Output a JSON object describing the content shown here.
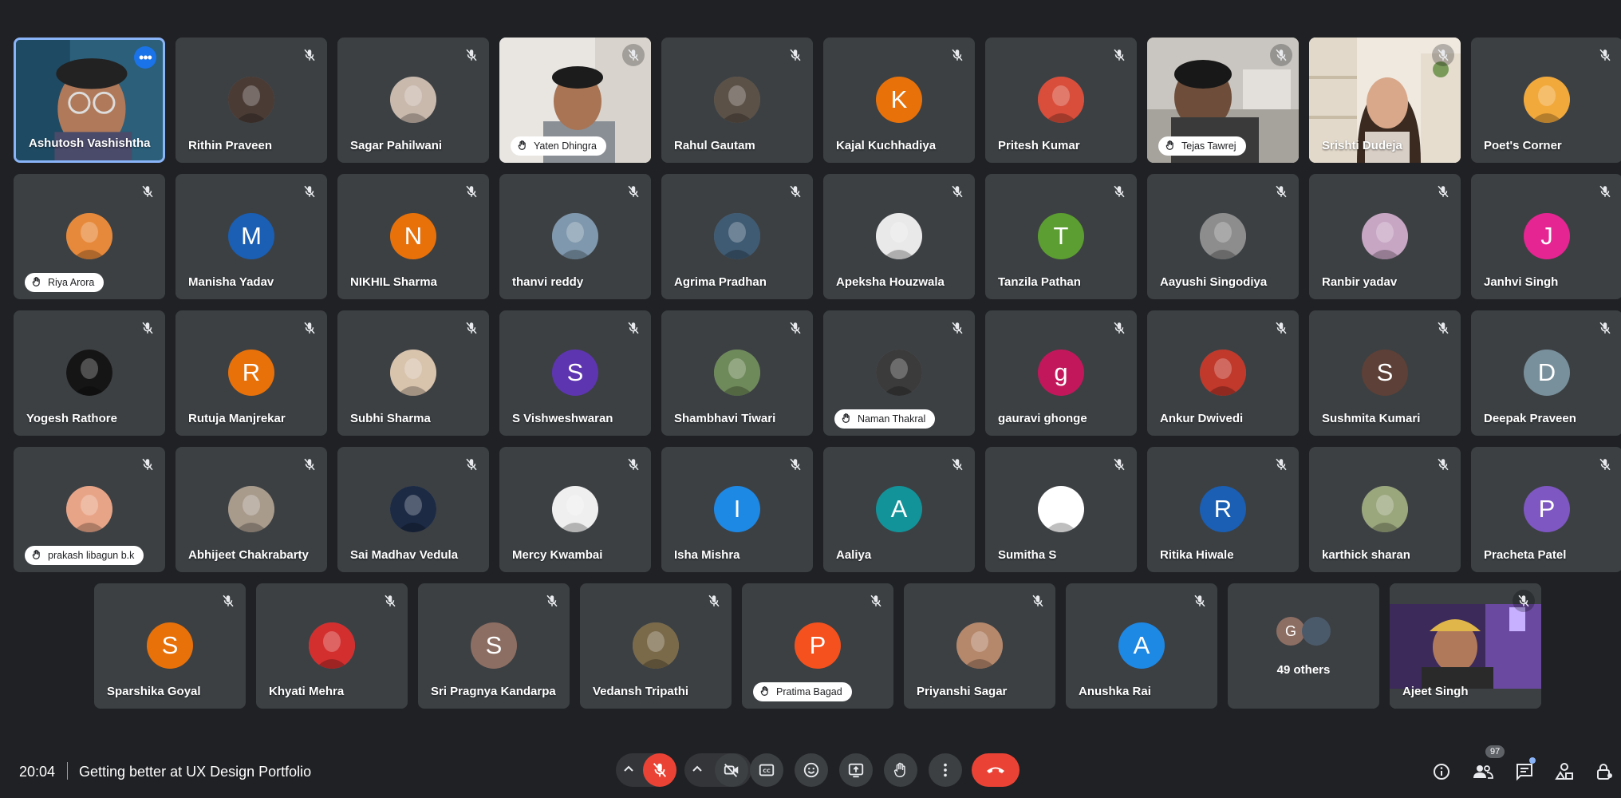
{
  "participants": [
    {
      "name": "Ashutosh Vashishtha",
      "kind": "video",
      "scene": "self",
      "speaking": true,
      "menu": true
    },
    {
      "name": "Rithin Praveen",
      "kind": "photo",
      "ph": "#4a3b35",
      "muted": true
    },
    {
      "name": "Sagar Pahilwani",
      "kind": "photo",
      "ph": "#c9b9ad",
      "muted": true
    },
    {
      "name": "Yaten Dhingra",
      "kind": "video",
      "scene": "wall",
      "pill": true,
      "muted": true
    },
    {
      "name": "Rahul Gautam",
      "kind": "photo",
      "ph": "#5b5147",
      "muted": true
    },
    {
      "name": "Kajal Kuchhadiya",
      "kind": "letter",
      "letter": "K",
      "color": "#e8710a",
      "muted": true
    },
    {
      "name": "Pritesh Kumar",
      "kind": "photo",
      "ph": "#d94e3b",
      "muted": true
    },
    {
      "name": "Tejas Tawrej",
      "kind": "video",
      "scene": "room",
      "pill": true,
      "muted": true
    },
    {
      "name": "Srishti Dudeja",
      "kind": "video",
      "scene": "shelf",
      "muted": true
    },
    {
      "name": "Poet's Corner",
      "kind": "photo",
      "ph": "#f2a93b",
      "muted": true
    },
    {
      "name": "Riya Arora",
      "kind": "photo",
      "ph": "#e7893a",
      "pill": true,
      "muted": true
    },
    {
      "name": "Manisha Yadav",
      "kind": "letter",
      "letter": "M",
      "color": "#1a5fb4",
      "muted": true
    },
    {
      "name": "NIKHIL Sharma",
      "kind": "letter",
      "letter": "N",
      "color": "#e8710a",
      "muted": true
    },
    {
      "name": "thanvi reddy",
      "kind": "photo",
      "ph": "#7f98ad",
      "muted": true
    },
    {
      "name": "Agrima Pradhan",
      "kind": "photo",
      "ph": "#3f5b73",
      "muted": true
    },
    {
      "name": "Apeksha Houzwala",
      "kind": "photo",
      "ph": "#e9e9e9",
      "muted": true
    },
    {
      "name": "Tanzila Pathan",
      "kind": "letter",
      "letter": "T",
      "color": "#5c9e31",
      "muted": true
    },
    {
      "name": "Aayushi Singodiya",
      "kind": "photo",
      "ph": "#8d8d8d",
      "muted": true
    },
    {
      "name": "Ranbir yadav",
      "kind": "photo",
      "ph": "#c7a6c4",
      "muted": true
    },
    {
      "name": "Janhvi Singh",
      "kind": "letter",
      "letter": "J",
      "color": "#e52592",
      "muted": true
    },
    {
      "name": "Yogesh Rathore",
      "kind": "photo",
      "ph": "#151515",
      "muted": true
    },
    {
      "name": "Rutuja Manjrekar",
      "kind": "letter",
      "letter": "R",
      "color": "#e8710a",
      "muted": true
    },
    {
      "name": "Subhi Sharma",
      "kind": "photo",
      "ph": "#d8c3ad",
      "muted": true
    },
    {
      "name": "S Vishweshwaran",
      "kind": "letter",
      "letter": "S",
      "color": "#5e35b1",
      "muted": true
    },
    {
      "name": "Shambhavi Tiwari",
      "kind": "photo",
      "ph": "#6f8a5a",
      "muted": true
    },
    {
      "name": "Naman Thakral",
      "kind": "photo",
      "ph": "#3b3b3b",
      "pill": true,
      "muted": true
    },
    {
      "name": "gauravi ghonge",
      "kind": "letter",
      "letter": "g",
      "color": "#c2185b",
      "muted": true
    },
    {
      "name": "Ankur Dwivedi",
      "kind": "photo",
      "ph": "#c0392b",
      "muted": true
    },
    {
      "name": "Sushmita Kumari",
      "kind": "letter",
      "letter": "S",
      "color": "#5d4037",
      "muted": true
    },
    {
      "name": "Deepak Praveen",
      "kind": "letter",
      "letter": "D",
      "color": "#78909c",
      "muted": true
    },
    {
      "name": "prakash libagun b.k",
      "kind": "photo",
      "ph": "#e8a487",
      "pill": true,
      "muted": true
    },
    {
      "name": "Abhijeet Chakrabarty",
      "kind": "photo",
      "ph": "#a89b8c",
      "muted": true
    },
    {
      "name": "Sai Madhav Vedula",
      "kind": "photo",
      "ph": "#1c2a44",
      "muted": true
    },
    {
      "name": "Mercy Kwambai",
      "kind": "photo",
      "ph": "#efefef",
      "muted": true
    },
    {
      "name": "Isha Mishra",
      "kind": "letter",
      "letter": "I",
      "color": "#1e88e5",
      "muted": true
    },
    {
      "name": "Aaliya",
      "kind": "letter",
      "letter": "A",
      "color": "#12939a",
      "muted": true
    },
    {
      "name": "Sumitha S",
      "kind": "photo",
      "ph": "#ffffff",
      "muted": true
    },
    {
      "name": "Ritika Hiwale",
      "kind": "letter",
      "letter": "R",
      "color": "#1a5fb4",
      "muted": true
    },
    {
      "name": "karthick sharan",
      "kind": "photo",
      "ph": "#9aa67c",
      "muted": true
    },
    {
      "name": "Pracheta Patel",
      "kind": "letter",
      "letter": "P",
      "color": "#7e57c2",
      "muted": true
    },
    {
      "name": "Sparshika Goyal",
      "kind": "letter",
      "letter": "S",
      "color": "#e8710a",
      "muted": true
    },
    {
      "name": "Khyati Mehra",
      "kind": "photo",
      "ph": "#d32f2f",
      "muted": true
    },
    {
      "name": "Sri Pragnya Kandarpa",
      "kind": "letter",
      "letter": "S",
      "color": "#8d6e63",
      "muted": true
    },
    {
      "name": "Vedansh Tripathi",
      "kind": "photo",
      "ph": "#7a6a4a",
      "muted": true
    },
    {
      "name": "Pratima Bagad",
      "kind": "letter",
      "letter": "P",
      "color": "#f4511e",
      "pill": true,
      "muted": true
    },
    {
      "name": "Priyanshi Sagar",
      "kind": "photo",
      "ph": "#b5876b",
      "muted": true
    },
    {
      "name": "Anushka Rai",
      "kind": "letter",
      "letter": "A",
      "color": "#1e88e5",
      "muted": true
    },
    {
      "name": "49 others",
      "kind": "others",
      "others_letter": "G"
    },
    {
      "name": "Ajeet Singh",
      "kind": "video",
      "scene": "purple",
      "muted": true
    }
  ],
  "bottom_bar": {
    "time": "20:04",
    "meeting_title": "Getting better at UX Design Portfolio",
    "people_count": "97"
  },
  "colors": {
    "background": "#202124",
    "tile": "#3c4043",
    "accent": "#8ab4f8",
    "danger": "#ea4335"
  }
}
